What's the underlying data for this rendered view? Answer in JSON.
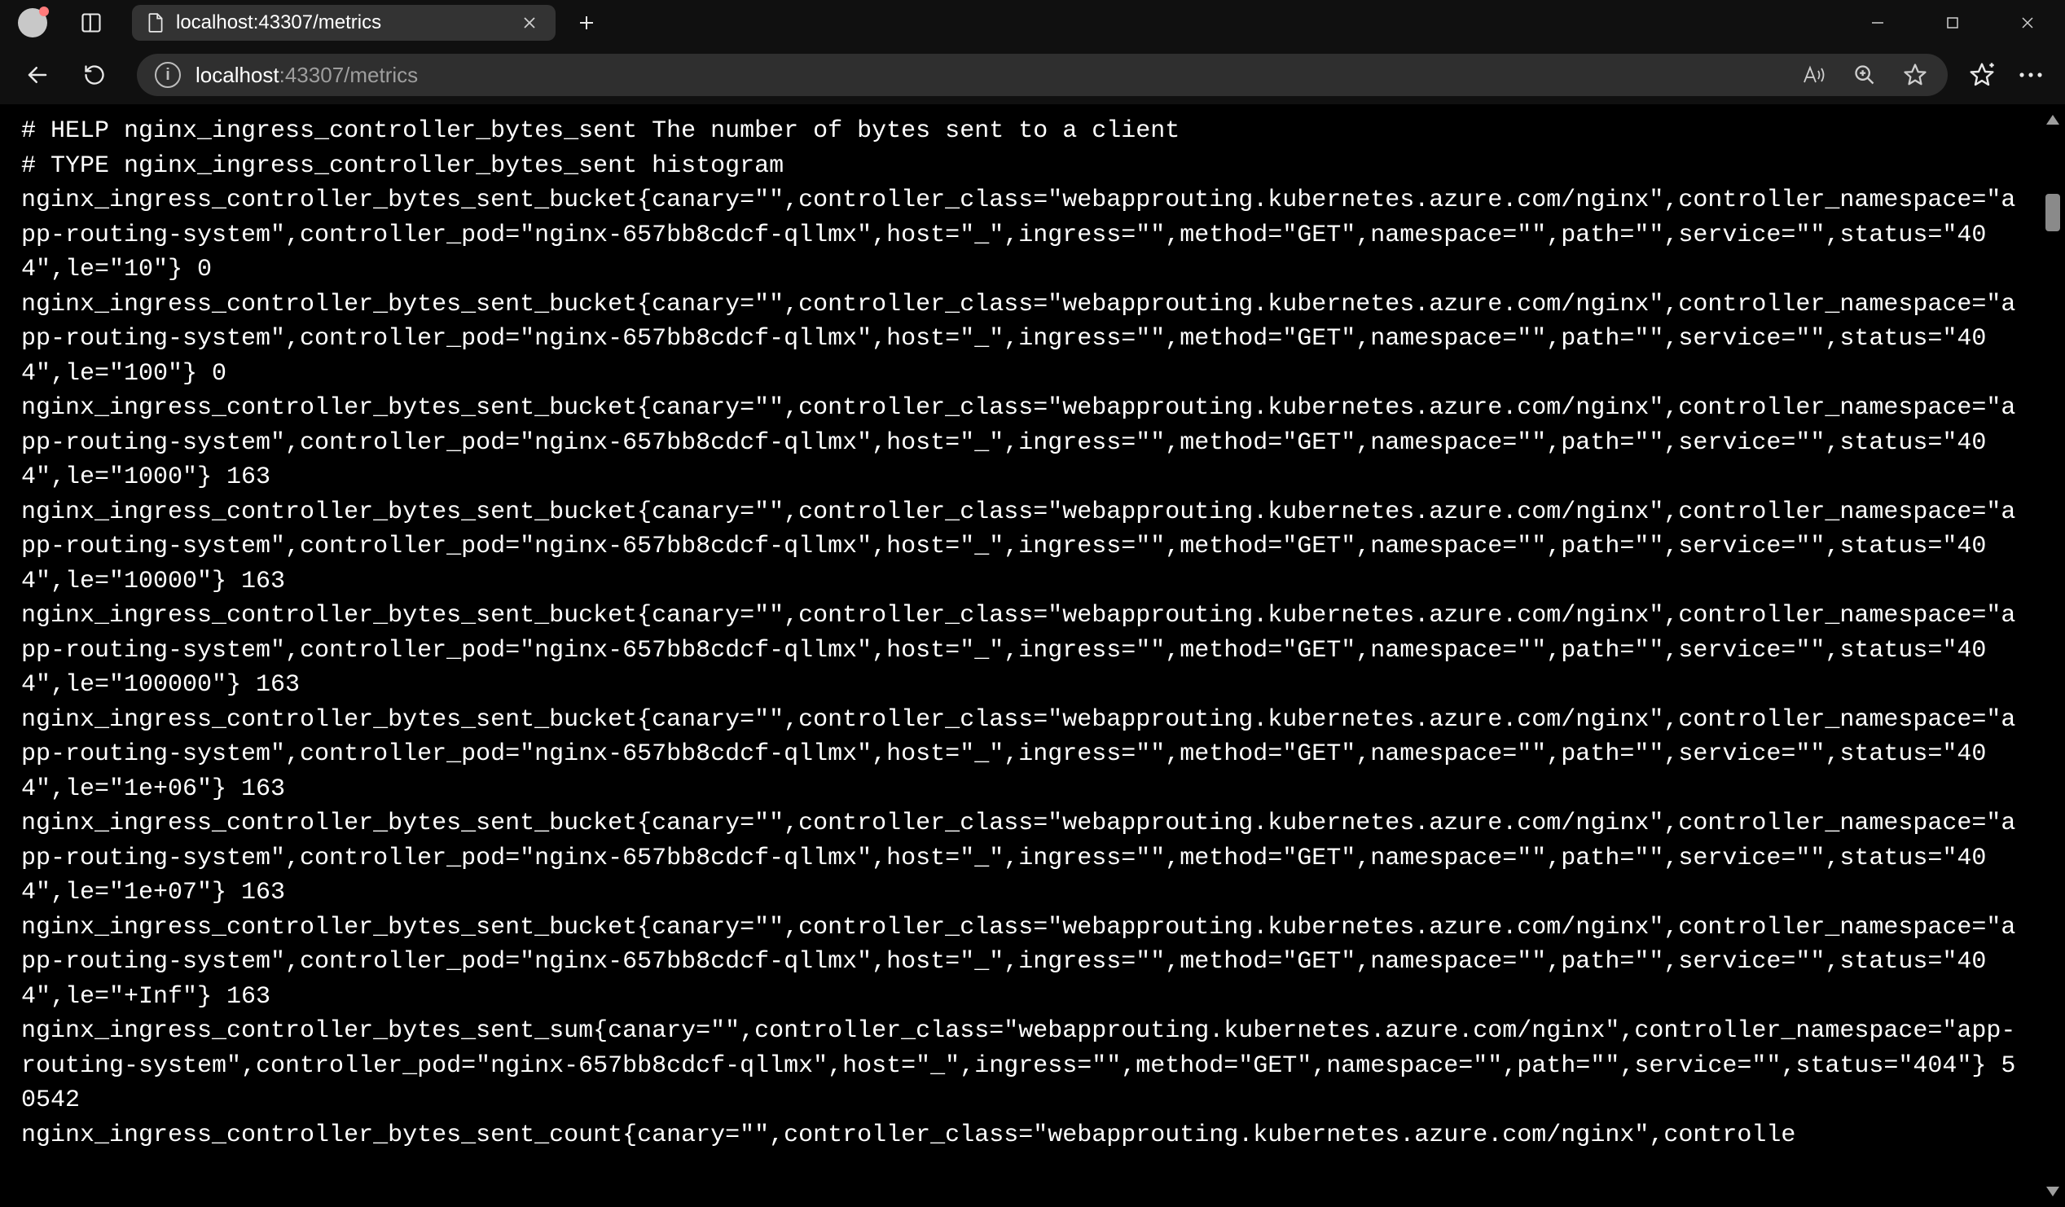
{
  "window": {
    "tab_title": "localhost:43307/metrics",
    "url_prefix": "localhost",
    "url_suffix": ":43307/metrics"
  },
  "metrics": {
    "metric_name": "nginx_ingress_controller_bytes_sent",
    "help_text": "The number of bytes sent to a client",
    "type": "histogram",
    "labels": {
      "canary": "",
      "controller_class": "webapprouting.kubernetes.azure.com/nginx",
      "controller_namespace": "app-routing-system",
      "controller_pod": "nginx-657bb8cdcf-qllmx",
      "host": "_",
      "ingress": "",
      "method": "GET",
      "namespace": "",
      "path": "",
      "service": "",
      "status": "404"
    },
    "buckets": [
      {
        "le": "10",
        "value": 0
      },
      {
        "le": "100",
        "value": 0
      },
      {
        "le": "1000",
        "value": 163
      },
      {
        "le": "10000",
        "value": 163
      },
      {
        "le": "100000",
        "value": 163
      },
      {
        "le": "1e+06",
        "value": 163
      },
      {
        "le": "1e+07",
        "value": 163
      },
      {
        "le": "+Inf",
        "value": 163
      }
    ],
    "sum": 50542,
    "count_partial_line_metric": "nginx_ingress_controller_bytes_sent_count",
    "count_line_truncated": true
  }
}
